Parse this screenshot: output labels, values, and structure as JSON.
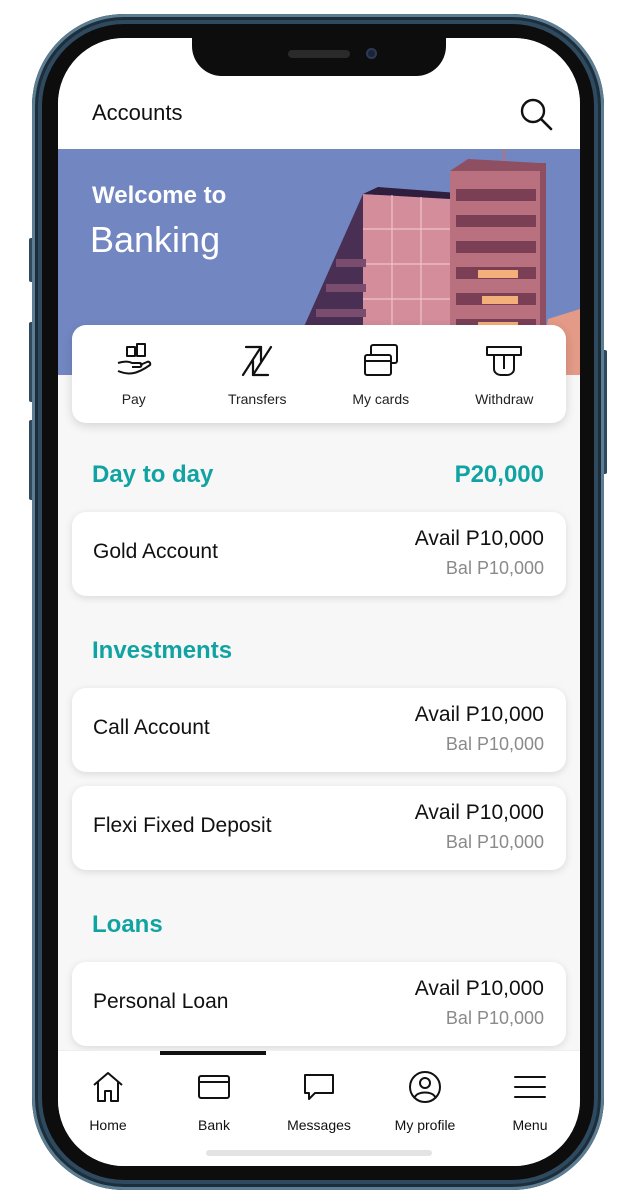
{
  "header": {
    "title": "Accounts",
    "search_icon": "search-icon"
  },
  "banner": {
    "line1": "Welcome to",
    "line2": "Banking"
  },
  "quick_actions": [
    {
      "label": "Pay",
      "icon": "hand-coins-icon"
    },
    {
      "label": "Transfers",
      "icon": "transfer-arrows-icon"
    },
    {
      "label": "My cards",
      "icon": "cards-icon"
    },
    {
      "label": "Withdraw",
      "icon": "cash-withdraw-icon"
    }
  ],
  "sections": {
    "day_to_day": {
      "title": "Day to day",
      "total": "P20,000",
      "accounts": [
        {
          "name": "Gold Account",
          "avail": "Avail P10,000",
          "bal": "Bal P10,000"
        }
      ]
    },
    "investments": {
      "title": "Investments",
      "accounts": [
        {
          "name": "Call Account",
          "avail": "Avail P10,000",
          "bal": "Bal P10,000"
        },
        {
          "name": "Flexi Fixed Deposit",
          "avail": "Avail P10,000",
          "bal": "Bal P10,000"
        }
      ]
    },
    "loans": {
      "title": "Loans",
      "accounts": [
        {
          "name": "Personal Loan",
          "avail": "Avail P10,000",
          "bal": "Bal P10,000"
        }
      ]
    }
  },
  "tabbar": {
    "items": [
      {
        "label": "Home",
        "icon": "home-icon"
      },
      {
        "label": "Bank",
        "icon": "bank-card-icon"
      },
      {
        "label": "Messages",
        "icon": "chat-bubble-icon"
      },
      {
        "label": "My profile",
        "icon": "user-circle-icon"
      },
      {
        "label": "Menu",
        "icon": "hamburger-menu-icon"
      }
    ],
    "selected": "Bank"
  },
  "colors": {
    "accent": "#11a3a3",
    "banner": "#7287c2",
    "building": "#c9808f",
    "card_bg": "#ffffff",
    "text": "#111111",
    "muted": "#8a8a8a"
  }
}
